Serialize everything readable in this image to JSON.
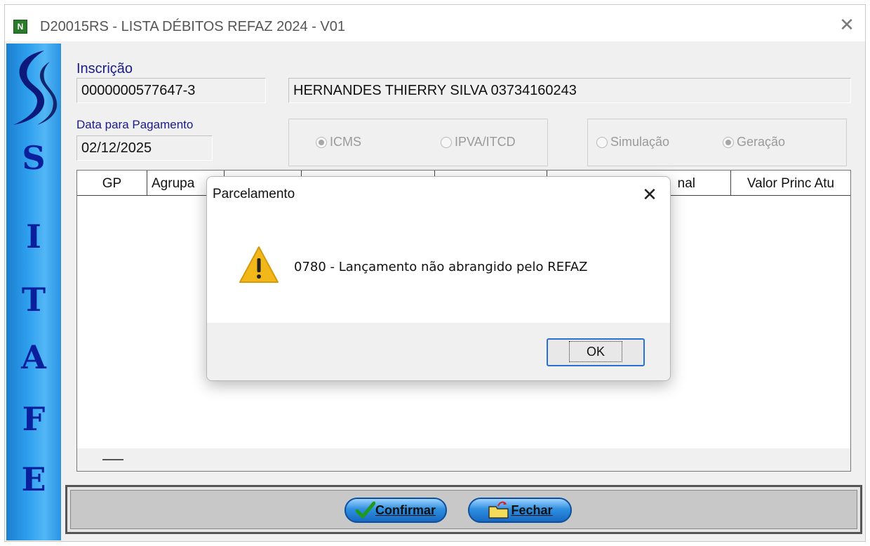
{
  "window": {
    "icon_letter": "N",
    "title": "D20015RS - LISTA DÉBITOS REFAZ 2024 - V01",
    "close_glyph": "✕"
  },
  "sidebar": {
    "letters": [
      "S",
      "I",
      "T",
      "A",
      "F",
      "E"
    ]
  },
  "form": {
    "inscricao_label": "Inscrição",
    "inscricao_value": "0000000577647-3",
    "name_value": "HERNANDES THIERRY SILVA 03734160243",
    "data_label": "Data para Pagamento",
    "data_value": "02/12/2025",
    "tax_options": [
      {
        "label": "ICMS",
        "selected": true
      },
      {
        "label": "IPVA/ITCD",
        "selected": false
      }
    ],
    "mode_options": [
      {
        "label": "Simulação",
        "selected": false
      },
      {
        "label": "Geração",
        "selected": true
      }
    ]
  },
  "grid": {
    "columns": [
      "GP",
      "Agrupa",
      "",
      "",
      "",
      "nal",
      "Valor Princ Atu"
    ]
  },
  "buttons": {
    "confirm_label": "Confirmar",
    "close_label": "Fechar"
  },
  "dialog": {
    "title": "Parcelamento",
    "close_glyph": "✕",
    "message": "0780 - Lançamento não abrangido pelo REFAZ",
    "ok_label": "OK",
    "warning_color": "#f2b81a"
  },
  "colors": {
    "sidebar_blue": "#2ea0ee",
    "sidebar_text": "#0a1f9c",
    "label_color": "#1a1a8a"
  }
}
